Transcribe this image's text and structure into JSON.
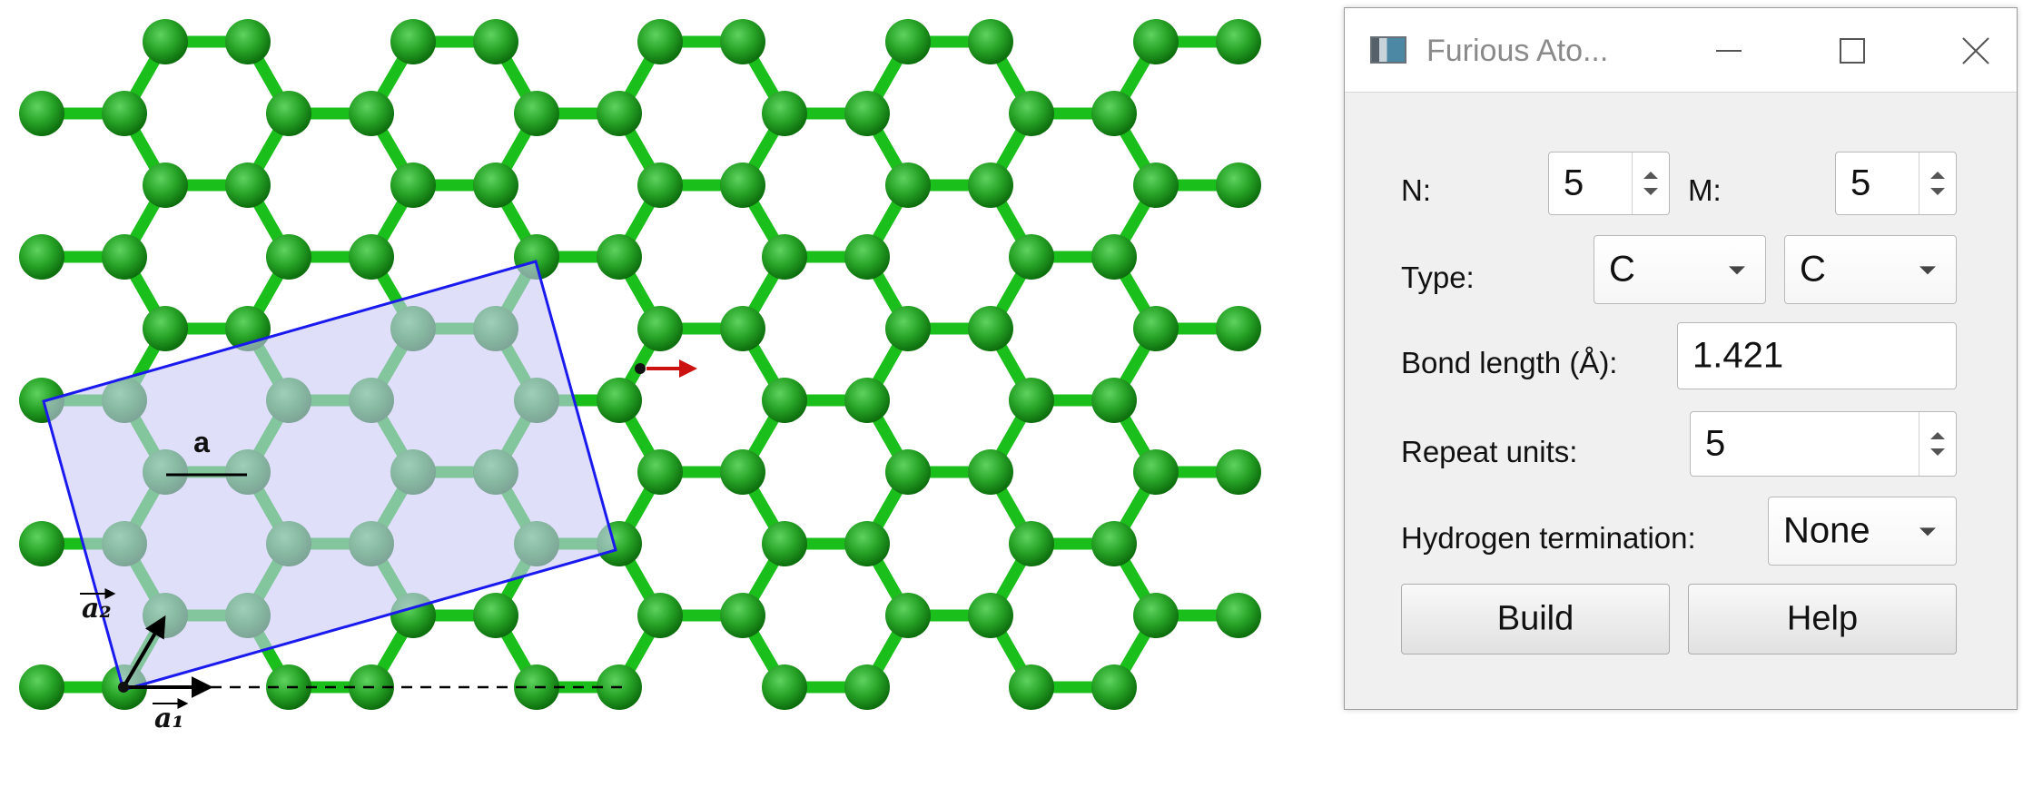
{
  "figure": {
    "bond_label": "a",
    "vector_a1": "a₁",
    "vector_a2": "a₂",
    "atom_color": "#2e9e2e",
    "bond_color": "#1bbf1b",
    "cell_fill": "#c9c9f5",
    "cell_stroke": "#1a1aee"
  },
  "window": {
    "title": "Furious Ato...",
    "icons": {
      "app": "app-icon",
      "minimize": "minimize-icon",
      "maximize": "maximize-icon",
      "close": "close-icon"
    },
    "form": {
      "n_label": "N:",
      "n_value": "5",
      "m_label": "M:",
      "m_value": "5",
      "type_label": "Type:",
      "type_a": "C",
      "type_b": "C",
      "bond_length_label": "Bond length (Å):",
      "bond_length_value": "1.421",
      "repeat_label": "Repeat units:",
      "repeat_value": "5",
      "hydrogen_label": "Hydrogen termination:",
      "hydrogen_value": "None"
    },
    "buttons": {
      "build": "Build",
      "help": "Help"
    }
  }
}
